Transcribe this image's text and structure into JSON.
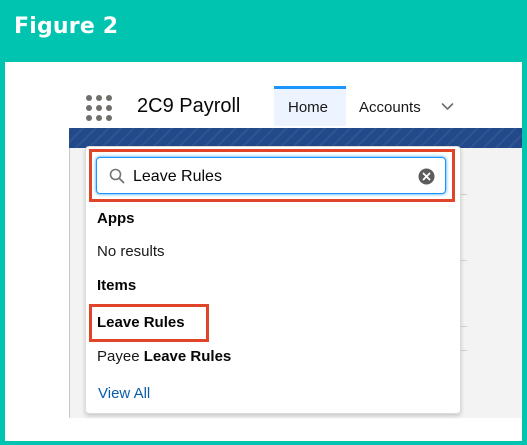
{
  "figure": {
    "title": "Figure 2"
  },
  "app": {
    "name": "2C9 Payroll",
    "tabs": [
      {
        "label": "Home",
        "active": true
      },
      {
        "label": "Accounts",
        "active": false
      }
    ]
  },
  "search": {
    "value": "Leave Rules",
    "placeholder": ""
  },
  "sections": {
    "apps": {
      "label": "Apps",
      "empty_text": "No results"
    },
    "items": {
      "label": "Items",
      "results": [
        {
          "prefix": "",
          "match": "Leave Rules"
        },
        {
          "prefix": "Payee ",
          "match": "Leave Rules"
        }
      ]
    }
  },
  "view_all_label": "View All",
  "colors": {
    "figure_bg": "#00c4b0",
    "highlight": "#e0452a",
    "focus": "#1b96ff",
    "link": "#0b5cab",
    "band": "#224a8a"
  },
  "icons": {
    "launcher": "app-launcher-icon",
    "chevron": "chevron-down-icon",
    "search": "search-icon",
    "clear": "clear-icon"
  }
}
